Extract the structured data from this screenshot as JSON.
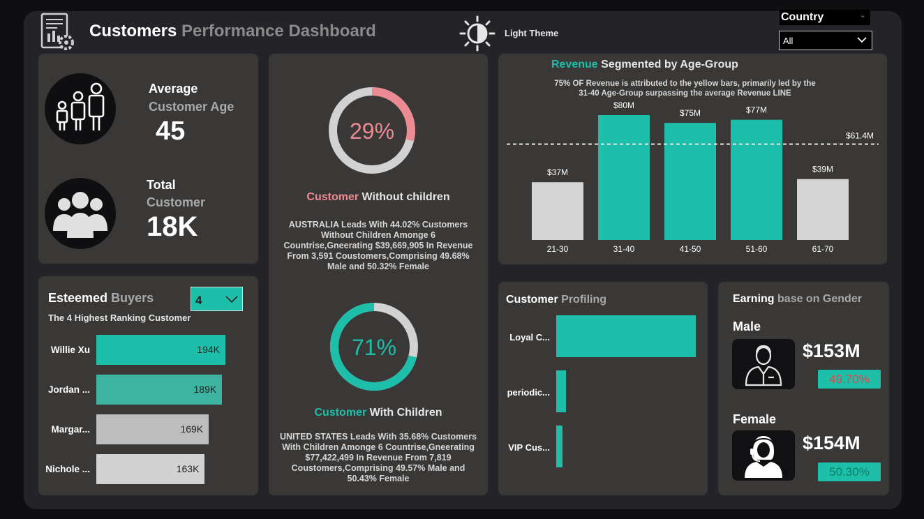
{
  "header": {
    "title_bold": "Customers",
    "title_rest": "Performance Dashboard",
    "theme_label": "Light Theme",
    "icon": "report-gear-icon"
  },
  "filter": {
    "label": "Country",
    "value": "All"
  },
  "age_card": {
    "line1": "Average",
    "line2": "Customer Age",
    "value": "45",
    "icon": "family-icon"
  },
  "total_card": {
    "line1": "Total",
    "line2": "Customer",
    "value": "18K",
    "icon": "group-icon"
  },
  "esteemed": {
    "title_bold": "Esteemed",
    "title_rest": "Buyers",
    "subtitle": "The 4 Highest Ranking Customer",
    "dropdown_value": "4",
    "rows": [
      {
        "name": "Willie Xu",
        "value": "194K",
        "num": 194,
        "color": "#1dbfaa"
      },
      {
        "name": "Jordan ...",
        "value": "189K",
        "num": 189,
        "color": "#3db3a2"
      },
      {
        "name": "Margar...",
        "value": "169K",
        "num": 169,
        "color": "#bdbdbd"
      },
      {
        "name": "Nichole ...",
        "value": "163K",
        "num": 163,
        "color": "#d2d2d2"
      }
    ]
  },
  "without_children": {
    "percent": "29%",
    "fraction": 0.29,
    "title_colored": "Customer",
    "title_rest": "Without children",
    "text": "AUSTRALIA Leads With 44.02% Customers Without Children Amonge 6 Countrise,Gneerating $39,669,905 In Revenue From 3,591 Coustomers,Comprising 49.68% Male and 50.32% Female"
  },
  "with_children": {
    "percent": "71%",
    "fraction": 0.71,
    "title_colored": "Customer",
    "title_rest": "With Children",
    "text": "UNITED STATES Leads With 35.68% Customers With Children Amonge 6 Countrise,Gneerating $77,422,499 In Revenue From 7,819 Coustomers,Comprising 49.57% Male and 50.43% Female"
  },
  "revenue": {
    "title_colored": "Revenue",
    "title_rest": "Segmented by Age-Group",
    "note_line1": "75% OF Revenue is attributed to the yellow bars, primarily led by the",
    "note_line2": "31-40 Age-Group surpassing  the average Revenue LINE",
    "avg_label": "$61.4M"
  },
  "chart_data": {
    "type": "bar",
    "categories": [
      "21-30",
      "31-40",
      "41-50",
      "51-60",
      "61-70"
    ],
    "values": [
      37,
      80,
      75,
      77,
      39
    ],
    "labels": [
      "$37M",
      "$80M",
      "$75M",
      "$77M",
      "$39M"
    ],
    "colors": [
      "#d4d4d4",
      "#1dbfaa",
      "#1dbfaa",
      "#1dbfaa",
      "#d4d4d4"
    ],
    "average": 61.4,
    "unit": "$M",
    "ylim": [
      0,
      80
    ]
  },
  "profiling": {
    "title_bold": "Customer",
    "title_rest": "Profiling",
    "rows": [
      {
        "name": "Loyal C...",
        "num": 100
      },
      {
        "name": "periodic...",
        "num": 7
      },
      {
        "name": "VIP Cus...",
        "num": 4.5
      }
    ]
  },
  "gender": {
    "title_bold": "Earning",
    "title_rest": "base on Gender",
    "male": {
      "label": "Male",
      "value": "$153M",
      "pct": "49.70%",
      "pct_color": "#d94a4a",
      "icon": "male-avatar-icon"
    },
    "female": {
      "label": "Female",
      "value": "$154M",
      "pct": "50.30%",
      "pct_color": "#0f7d63",
      "icon": "female-headset-icon"
    }
  }
}
